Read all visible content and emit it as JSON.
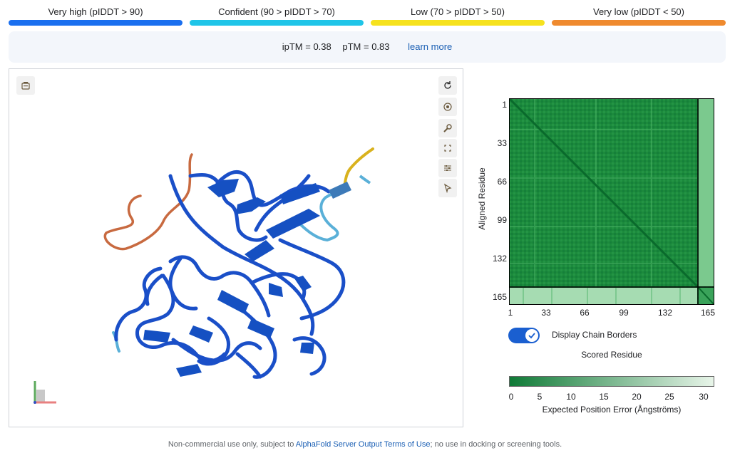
{
  "confidence_legend": [
    {
      "label": "Very high (pIDDT > 90)",
      "color": "#1a6fef"
    },
    {
      "label": "Confident (90 > pIDDT > 70)",
      "color": "#1fc5e8"
    },
    {
      "label": "Low (70 > pIDDT > 50)",
      "color": "#f6e21e"
    },
    {
      "label": "Very low (pIDDT < 50)",
      "color": "#ef8a2e"
    }
  ],
  "metrics": {
    "iptm": "ipTM = 0.38",
    "ptm": "pTM = 0.83",
    "learn_more": "learn more"
  },
  "viewer_tools": {
    "icons": [
      "rotate-icon",
      "center-icon",
      "wrench-icon",
      "fullscreen-icon",
      "settings-sliders-icon",
      "select-cursor-icon"
    ],
    "snapshot_icon": "camera-snapshot-icon"
  },
  "pae": {
    "y_axis_label": "Aligned Residue",
    "x_axis_label": "Scored Residue",
    "y_ticks": [
      "1",
      "33",
      "66",
      "99",
      "132",
      "165"
    ],
    "x_ticks": [
      "1",
      "33",
      "66",
      "99",
      "132",
      "165"
    ],
    "toggle_label": "Display Chain Borders",
    "toggle_on": true,
    "colorbar_ticks": [
      "0",
      "5",
      "10",
      "15",
      "20",
      "25",
      "30"
    ],
    "colorbar_label": "Expected Position Error (Ångströms)",
    "colorbar_colors": [
      "#0f7a36",
      "#e8f5e9"
    ]
  },
  "footer": {
    "prefix": "Non-commercial use only, subject to ",
    "link": "AlphaFold Server Output Terms of Use",
    "suffix": "; no use in docking or screening tools."
  }
}
